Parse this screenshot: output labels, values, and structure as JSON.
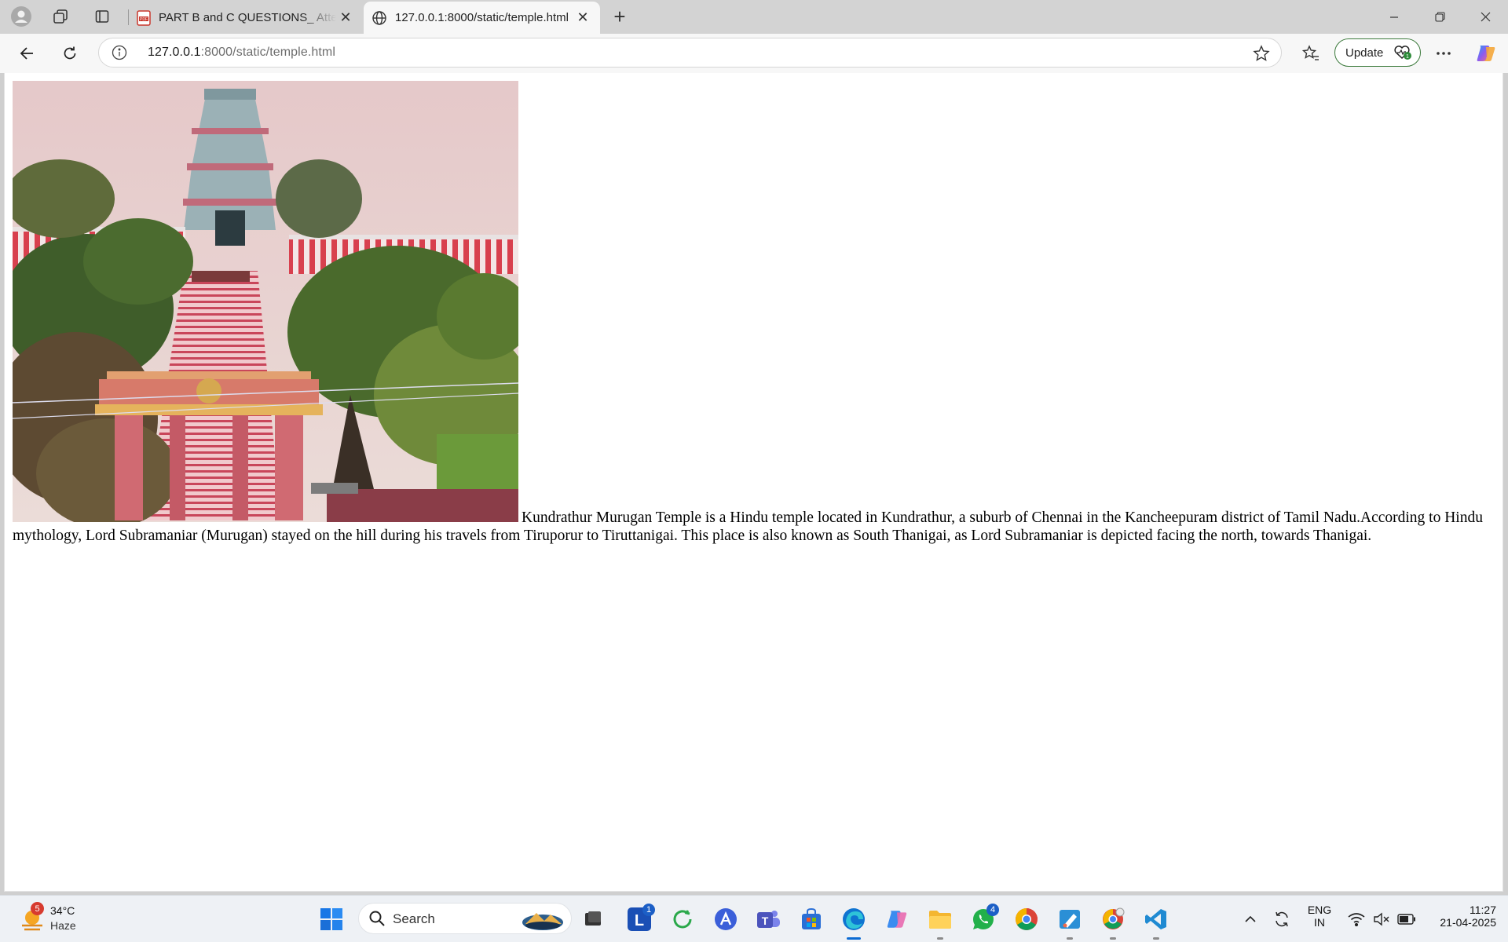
{
  "browser": {
    "tabs": [
      {
        "title": "PART B and C QUESTIONS_ Attem",
        "icon": "pdf-icon"
      },
      {
        "title": "127.0.0.1:8000/static/temple.html",
        "icon": "globe-icon"
      }
    ],
    "address": {
      "host": "127.0.0.1",
      "rest": ":8000/static/temple.html"
    },
    "update_label": "Update"
  },
  "page": {
    "image_alt": "Kundrathur Murugan Temple",
    "paragraph": "Kundrathur Murugan Temple is a Hindu temple located in Kundrathur, a suburb of Chennai in the Kancheepuram district of Tamil Nadu.According to Hindu mythology, Lord Subramaniar (Murugan) stayed on the hill during his travels from Tiruporur to Tiruttanigai. This place is also known as South Thanigai, as Lord Subramaniar is depicted facing the north, towards Thanigai."
  },
  "taskbar": {
    "weather": {
      "temp": "34°C",
      "condition": "Haze",
      "badge": "5"
    },
    "search_placeholder": "Search",
    "badges": {
      "lens": "1",
      "whatsapp": "4"
    },
    "tray": {
      "lang": "ENG",
      "region": "IN",
      "time": "11:27",
      "date": "21-04-2025"
    }
  }
}
